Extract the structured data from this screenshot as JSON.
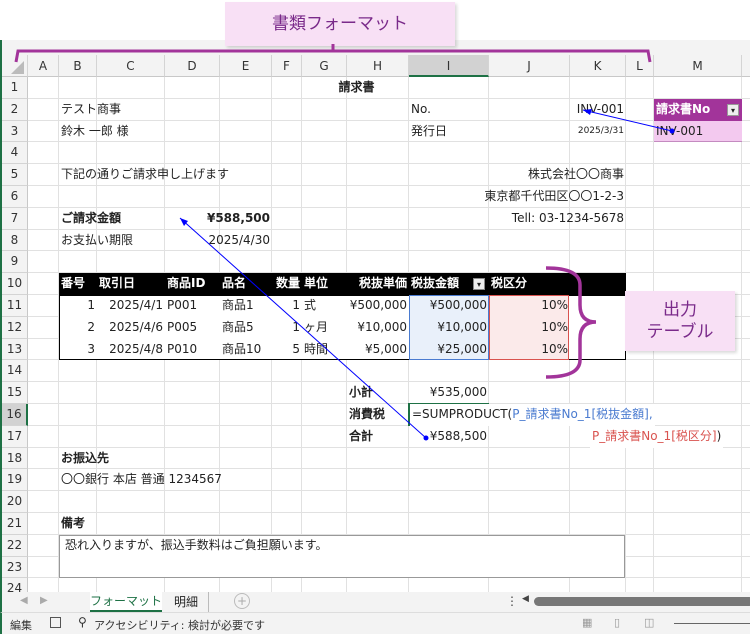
{
  "columns": [
    "A",
    "B",
    "C",
    "D",
    "E",
    "F",
    "G",
    "H",
    "I",
    "J",
    "K",
    "L",
    "M"
  ],
  "rows": [
    1,
    2,
    3,
    4,
    5,
    6,
    7,
    8,
    9,
    10,
    11,
    12,
    13,
    14,
    15,
    16,
    17,
    18,
    19,
    20,
    21,
    22,
    23,
    24
  ],
  "selected_cell": "I16",
  "cells": [
    {
      "ref": "H1",
      "text": "請求書"
    },
    {
      "ref": "B2",
      "text": "テスト商事"
    },
    {
      "ref": "I2",
      "text": "No."
    },
    {
      "ref": "K2",
      "text": "INV-001"
    },
    {
      "ref": "B3",
      "text": "鈴木 一郎 様"
    },
    {
      "ref": "I3",
      "text": "発行日"
    },
    {
      "ref": "K3",
      "text": "2025/3/31"
    },
    {
      "ref": "B5",
      "text": "下記の通りご請求申し上げます"
    },
    {
      "ref": "K5",
      "text": "株式会社〇〇商事"
    },
    {
      "ref": "K6",
      "text": "東京都千代田区〇〇1-2-3"
    },
    {
      "ref": "K7",
      "text": "Tell: 03-1234-5678"
    },
    {
      "ref": "B7",
      "text": "ご請求金額"
    },
    {
      "ref": "D7",
      "text": "¥588,500"
    },
    {
      "ref": "B8",
      "text": "お支払い期限"
    },
    {
      "ref": "D8",
      "text": "2025/4/30"
    },
    {
      "ref": "H15",
      "text": "小計"
    },
    {
      "ref": "I15",
      "text": "¥535,000"
    },
    {
      "ref": "H16",
      "text": "消費税"
    },
    {
      "ref": "H17",
      "text": "合計"
    },
    {
      "ref": "I17",
      "text": "¥588,500"
    },
    {
      "ref": "B18",
      "text": "お振込先"
    },
    {
      "ref": "B19",
      "text": "〇〇銀行 本店 普通 1234567"
    },
    {
      "ref": "B21",
      "text": "備考"
    },
    {
      "ref": "B22",
      "text": "恐れ入りますが、振込手数料はご負担願います。"
    }
  ],
  "formula": {
    "prefix": "=SUMPRODUCT(",
    "arg1": "P_請求書No_1[税抜金額]",
    "sep": ",",
    "arg2": "P_請求書No_1[税区分]",
    "suffix": ")"
  },
  "lookup_table": {
    "header": "請求書No",
    "value": "INV-001"
  },
  "invoice_table": {
    "headers": [
      "番号",
      "取引日",
      "商品ID",
      "品名",
      "数量",
      "単位",
      "税抜単価",
      "税抜金額",
      "税区分"
    ],
    "rows": [
      [
        "1",
        "2025/4/1",
        "P001",
        "商品1",
        "1",
        "式",
        "¥500,000",
        "¥500,000",
        "10%"
      ],
      [
        "2",
        "2025/4/6",
        "P005",
        "商品5",
        "1",
        "ヶ月",
        "¥10,000",
        "¥10,000",
        "10%"
      ],
      [
        "3",
        "2025/4/8",
        "P010",
        "商品10",
        "5",
        "時間",
        "¥5,000",
        "¥25,000",
        "10%"
      ]
    ]
  },
  "callouts": {
    "format": "書類フォーマット",
    "output_line1": "出力",
    "output_line2": "テーブル"
  },
  "sheet_tabs": [
    {
      "label": "フォーマット",
      "active": true
    },
    {
      "label": "明細",
      "active": false
    }
  ],
  "status_bar": {
    "mode": "編集",
    "accessibility": "アクセシビリティ: 検討が必要です"
  },
  "colors": {
    "accent": "#a2349a",
    "callout_bg": "#f8e0f5",
    "table_header": "#000000",
    "excel_green": "#1e7145",
    "arrow": "#0000ff"
  },
  "icons": [
    "select-all-icon",
    "dropdown-icon",
    "tab-prev-icon",
    "tab-next-icon",
    "add-sheet-icon",
    "macro-record-icon",
    "accessibility-icon",
    "normal-view-icon",
    "page-layout-icon",
    "page-break-icon"
  ]
}
